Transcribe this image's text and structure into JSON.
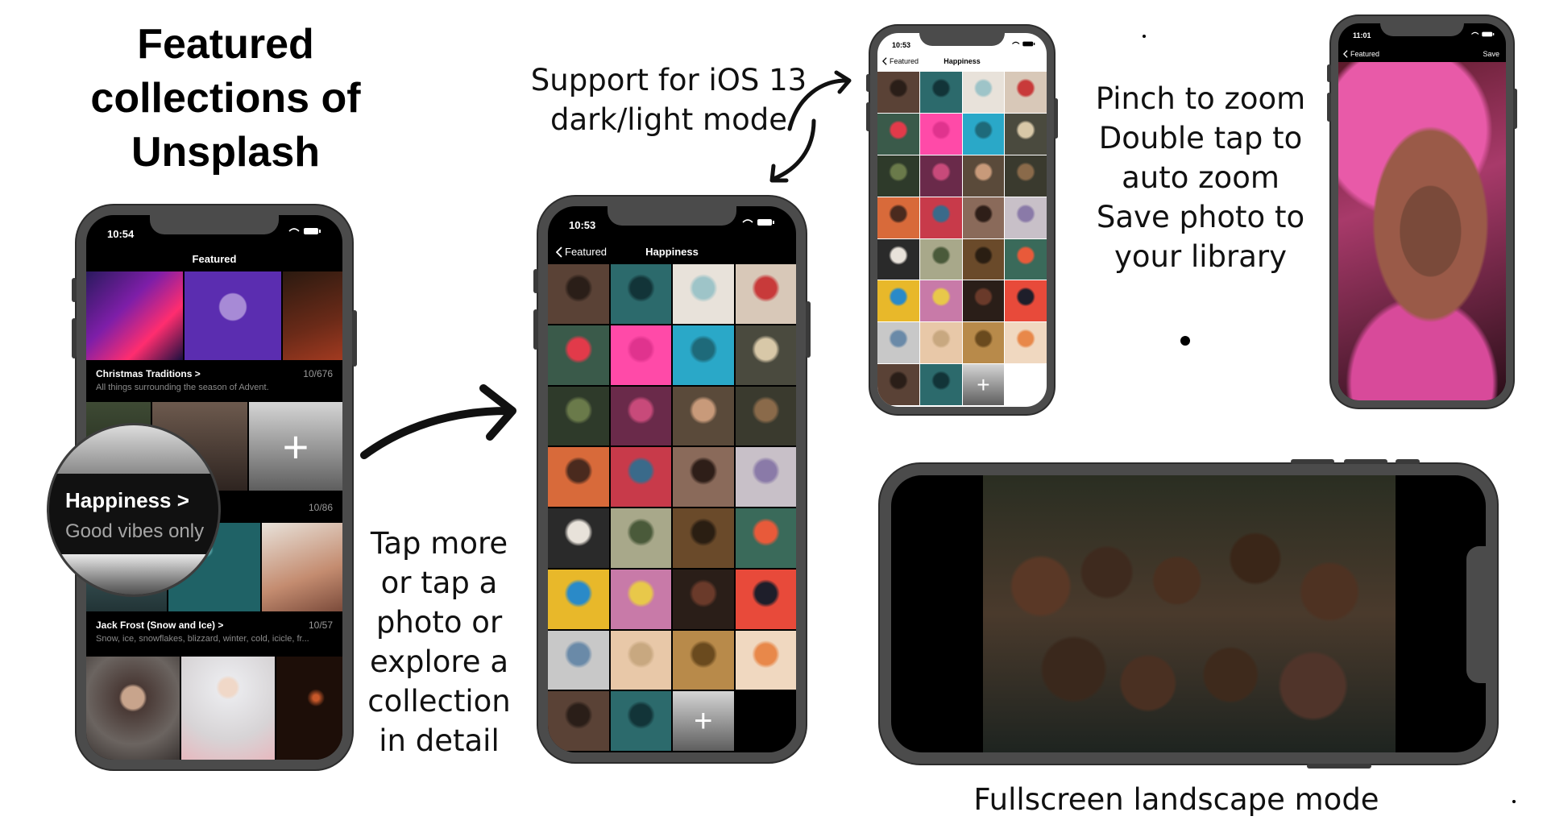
{
  "headline": [
    "Featured",
    "collections of",
    "Unsplash"
  ],
  "captions": {
    "mode": [
      "Support for iOS 13",
      "dark/light mode"
    ],
    "tap": [
      "Tap more",
      "or tap a",
      "photo or",
      "explore a",
      "collection",
      "in detail"
    ],
    "zoom": [
      "Pinch to zoom",
      "Double tap to",
      "auto zoom",
      "Save photo to",
      "your library"
    ],
    "landscape": "Fullscreen landscape mode"
  },
  "phone1": {
    "time": "10:54",
    "nav_title": "Featured",
    "collections": [
      {
        "name": "Christmas Traditions",
        "chevron": ">",
        "count": "10/676",
        "desc": "All things surrounding the season of Advent."
      },
      {
        "name": "Happiness",
        "chevron": ">",
        "count": "10/86",
        "desc": "Good vibes only"
      },
      {
        "name": "Jack Frost (Snow and Ice)",
        "chevron": ">",
        "count": "10/57",
        "desc": "Snow, ice, snowflakes, blizzard, winter, cold, icicle, fr..."
      }
    ],
    "plus": "+"
  },
  "phone2": {
    "time": "10:53",
    "back_label": "Featured",
    "nav_title": "Happiness",
    "plus": "+"
  },
  "phone3": {
    "time": "10:53",
    "back_label": "Featured",
    "nav_title": "Happiness",
    "plus": "+"
  },
  "phone4": {
    "time": "11:01",
    "back_label": "Featured",
    "save_label": "Save"
  },
  "colors": {
    "bezel": "#4b4b4b",
    "dark_screen": "#000000",
    "light_screen": "#ffffff"
  }
}
